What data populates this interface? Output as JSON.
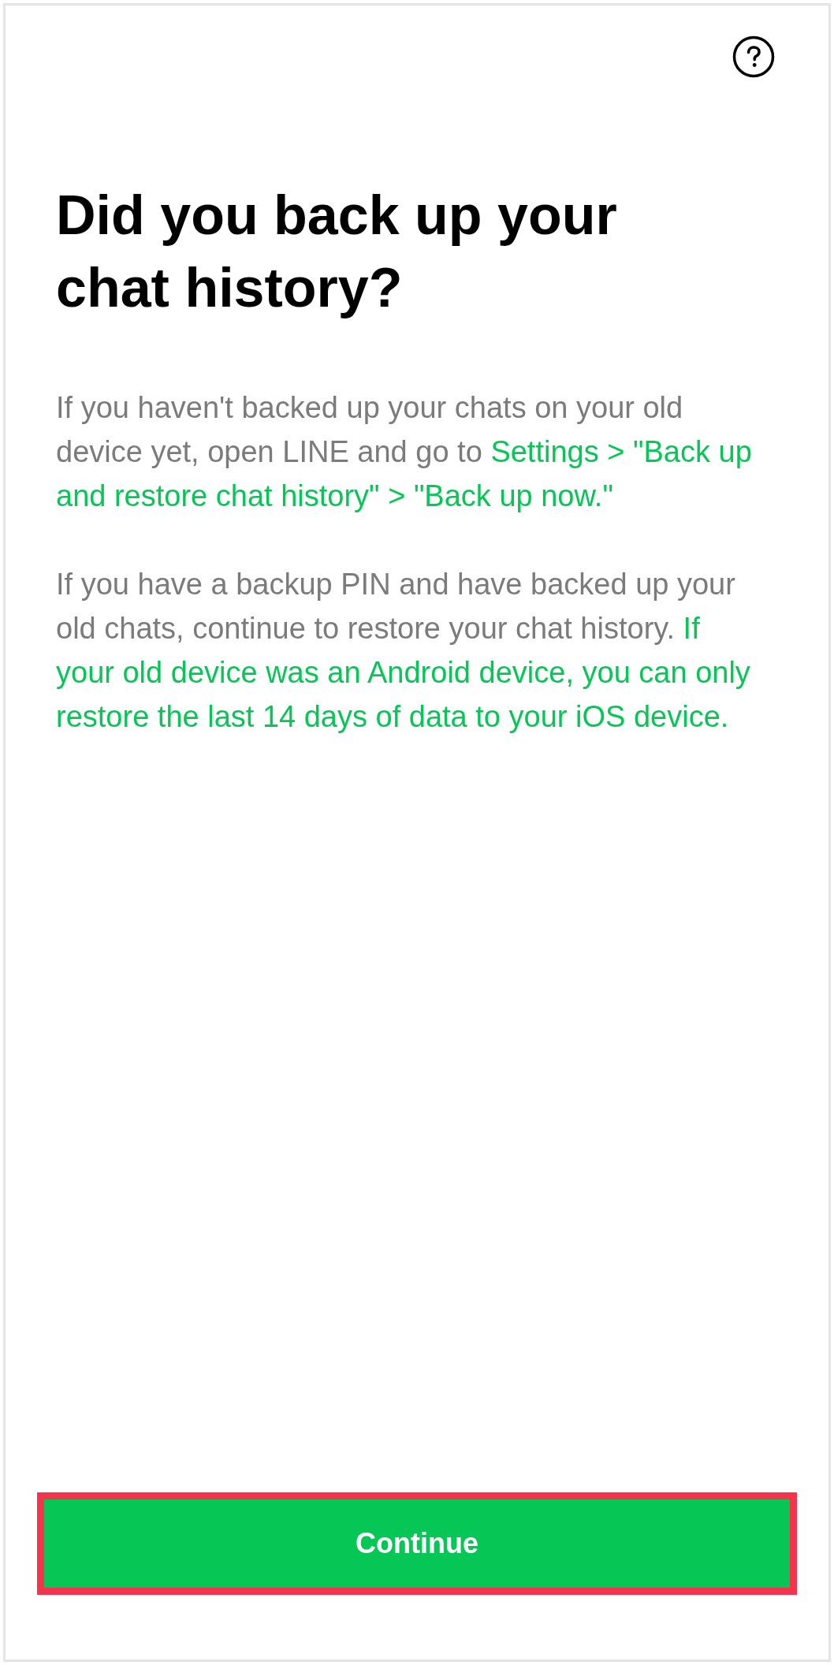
{
  "title": "Did you back up your chat history?",
  "paragraphs": [
    {
      "segments": [
        {
          "kind": "plain",
          "text": "If you haven't backed up your chats on your old device yet, open LINE and go to "
        },
        {
          "kind": "accent",
          "text": "Settings > \"Back up and restore chat history\" > \"Back up now.\""
        }
      ]
    },
    {
      "segments": [
        {
          "kind": "plain",
          "text": "If you have a backup PIN and have backed up your old chats, continue to restore your chat history. "
        },
        {
          "kind": "accent",
          "text": "If your old device was an Android device, you can only restore the last 14 days of data to your iOS device."
        }
      ]
    }
  ],
  "button": {
    "label": "Continue",
    "highlighted": true
  }
}
